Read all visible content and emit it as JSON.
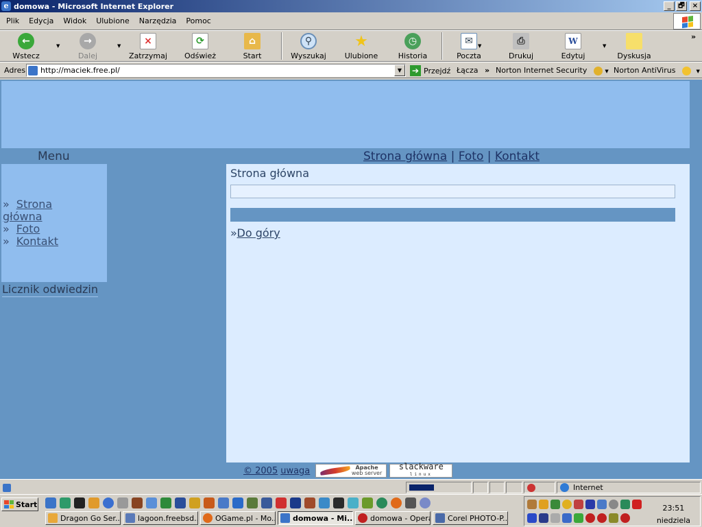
{
  "window": {
    "title": "domowa - Microsoft Internet Explorer",
    "controls": [
      "_",
      "🗗",
      "×"
    ]
  },
  "menubar": {
    "items": [
      "Plik",
      "Edycja",
      "Widok",
      "Ulubione",
      "Narzędzia",
      "Pomoc"
    ]
  },
  "toolbar": {
    "back": "Wstecz",
    "forward": "Dalej",
    "stop": "Zatrzymaj",
    "refresh": "Odśwież",
    "home": "Start",
    "search": "Wyszukaj",
    "favorites": "Ulubione",
    "history": "Historia",
    "mail": "Poczta",
    "print": "Drukuj",
    "edit": "Edytuj",
    "discuss": "Dyskusja",
    "more": "»"
  },
  "addressbar": {
    "label": "Adres",
    "url": "http://maciek.free.pl/",
    "go": "Przejdź",
    "links": "Łącza",
    "chevron": "»",
    "norton_security": "Norton Internet Security",
    "norton_antivirus": "Norton AntiVirus"
  },
  "page": {
    "menu_heading": "Menu",
    "topnav": {
      "home": "Strona główna",
      "sep1": " | ",
      "photo": "Foto",
      "sep2": " | ",
      "contact": "Kontakt"
    },
    "sidebar": {
      "mark": "»",
      "items": [
        {
          "label_line1": "Strona",
          "label_line2": "główna"
        },
        {
          "label": "Foto"
        },
        {
          "label": "Kontakt"
        }
      ]
    },
    "counter_label": "Licznik odwiedzin",
    "content": {
      "title": "Strona główna",
      "up_mark": "»",
      "up_link": "Do góry"
    },
    "footer": {
      "copyright": "© 2005",
      "uwaga": "uwaga",
      "apache_line1": "Apache",
      "apache_line2": "web server",
      "slackware": "slackware",
      "slackware_sub": "linux"
    }
  },
  "statusbar": {
    "zone": "Internet"
  },
  "taskbar": {
    "start": "Start",
    "tasks": [
      "Dragon Go Ser...",
      "lagoon.freebsd...",
      "OGame.pl - Mo...",
      "domowa - Mi...",
      "domowa - Opera",
      "Corel PHOTO-P..."
    ],
    "active_index": 3,
    "clock_time": "23:51",
    "clock_day": "niedziela"
  }
}
